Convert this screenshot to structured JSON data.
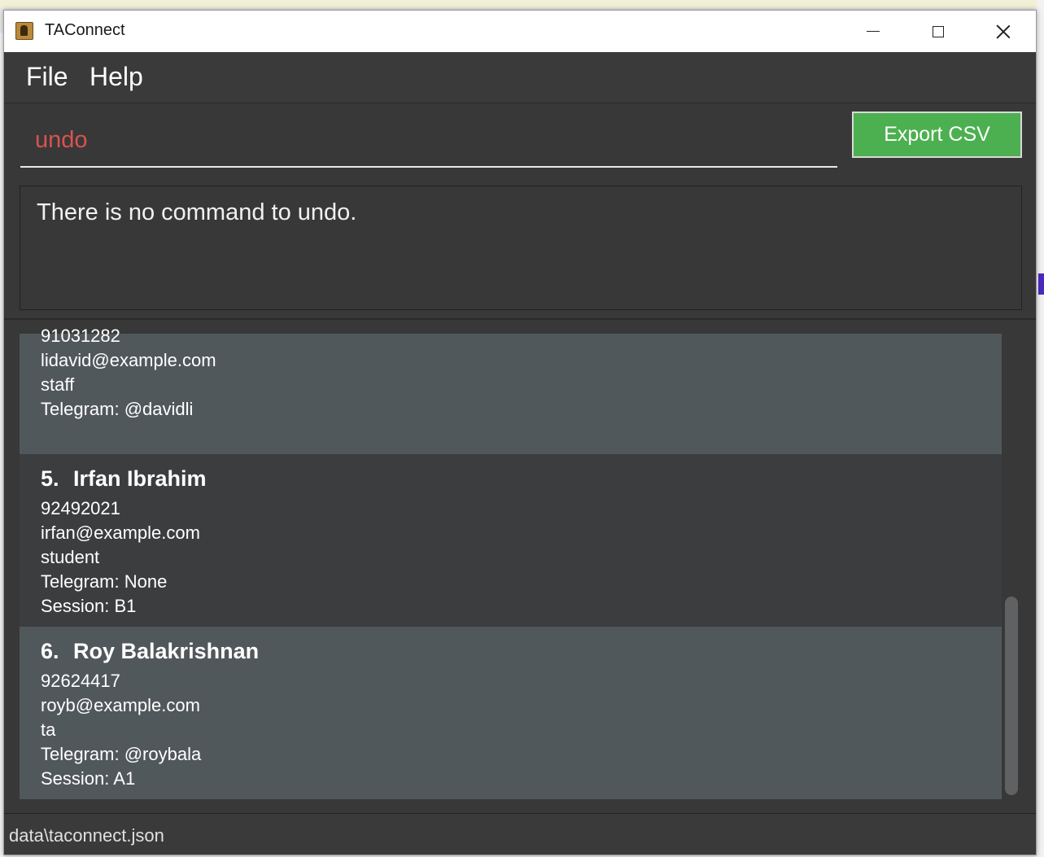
{
  "window": {
    "title": "TAConnect"
  },
  "menu": {
    "file": "File",
    "help": "Help"
  },
  "command": {
    "value": "undo"
  },
  "export_button": {
    "label": "Export CSV"
  },
  "result": {
    "message": "There is no command to undo."
  },
  "contacts": [
    {
      "phone": "91031282",
      "email": "lidavid@example.com",
      "role": "staff",
      "telegram": "Telegram: @davidli"
    },
    {
      "index": "5.",
      "name": "Irfan Ibrahim",
      "phone": "92492021",
      "email": "irfan@example.com",
      "role": "student",
      "telegram": "Telegram: None",
      "session": "Session: B1"
    },
    {
      "index": "6.",
      "name": "Roy Balakrishnan",
      "phone": "92624417",
      "email": "royb@example.com",
      "role": "ta",
      "telegram": "Telegram: @roybala",
      "session": "Session: A1"
    }
  ],
  "status": {
    "file_path": "data\\taconnect.json"
  }
}
